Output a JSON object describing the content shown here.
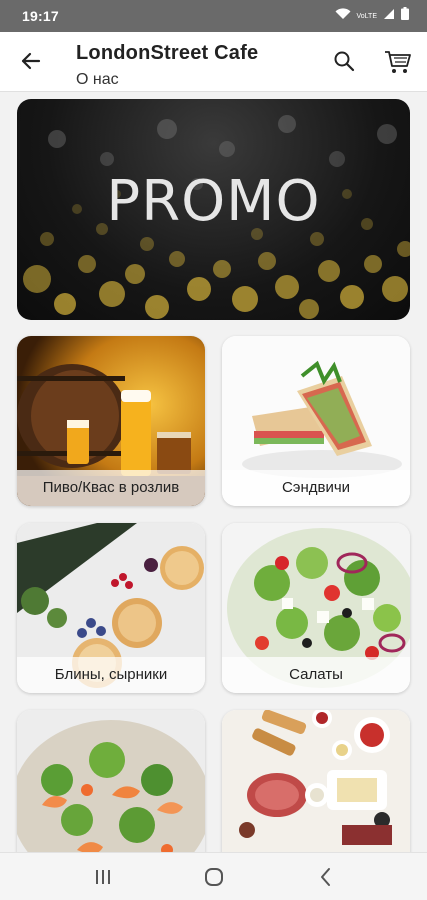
{
  "status_bar": {
    "time": "19:17",
    "volte_label": "VoLTE"
  },
  "app_bar": {
    "title": "LondonStreet Cafe",
    "subtitle": "О нас"
  },
  "promo": {
    "text": "PROMO"
  },
  "categories": [
    {
      "label": "Пиво/Квас в розлив"
    },
    {
      "label": "Сэндвичи"
    },
    {
      "label": "Блины, сырники"
    },
    {
      "label": "Салаты"
    },
    {
      "label": ""
    },
    {
      "label": ""
    }
  ],
  "colors": {
    "statusbar": "#6a6a6a",
    "appbar": "#ffffff",
    "background": "#f2f2f2",
    "bokeh": "#d4b23a"
  }
}
